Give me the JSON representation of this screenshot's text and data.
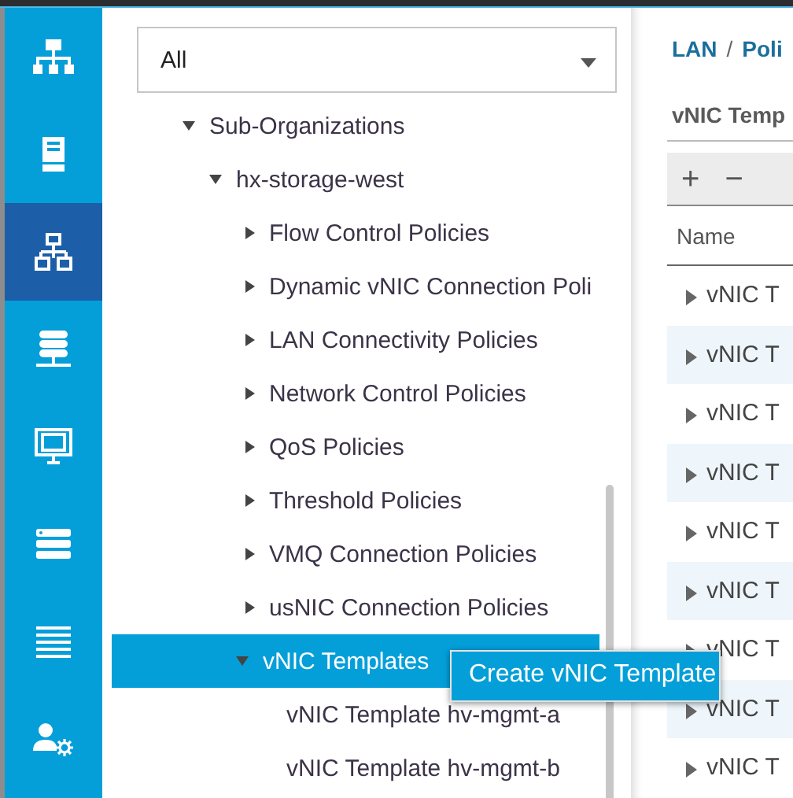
{
  "nav": {
    "items": [
      {
        "kind": "equipment",
        "selected": false
      },
      {
        "kind": "servers",
        "selected": false
      },
      {
        "kind": "lan",
        "selected": true
      },
      {
        "kind": "san",
        "selected": false
      },
      {
        "kind": "vm",
        "selected": false
      },
      {
        "kind": "storage",
        "selected": false
      },
      {
        "kind": "chassis",
        "selected": false
      },
      {
        "kind": "admin",
        "selected": false
      }
    ]
  },
  "tree": {
    "filter": {
      "value": "All"
    },
    "nodes": [
      {
        "label": "Sub-Organizations",
        "expanded": true,
        "selected": false,
        "children": [
          {
            "label": "hx-storage-west",
            "expanded": true,
            "selected": false,
            "children": [
              {
                "label": "Flow Control Policies",
                "expanded": false,
                "selected": false
              },
              {
                "label": "Dynamic vNIC Connection Poli",
                "expanded": false,
                "selected": false
              },
              {
                "label": "LAN Connectivity Policies",
                "expanded": false,
                "selected": false
              },
              {
                "label": "Network Control Policies",
                "expanded": false,
                "selected": false
              },
              {
                "label": "QoS Policies",
                "expanded": false,
                "selected": false
              },
              {
                "label": "Threshold Policies",
                "expanded": false,
                "selected": false
              },
              {
                "label": "VMQ Connection Policies",
                "expanded": false,
                "selected": false
              },
              {
                "label": "usNIC Connection Policies",
                "expanded": false,
                "selected": false
              },
              {
                "label": "vNIC Templates",
                "expanded": true,
                "selected": true,
                "children": [
                  {
                    "label": "vNIC Template hv-mgmt-a",
                    "selected": false
                  },
                  {
                    "label": "vNIC Template hv-mgmt-b",
                    "selected": false
                  }
                ]
              }
            ]
          }
        ]
      }
    ]
  },
  "context_menu": {
    "items": [
      "Create vNIC Template"
    ]
  },
  "detail": {
    "breadcrumb": [
      "LAN",
      "/",
      "Poli"
    ],
    "title": "vNIC Temp",
    "toolbar": [
      "+",
      "−"
    ],
    "columns": [
      "Name"
    ],
    "rows": [
      {
        "label": "vNIC T",
        "expanded": false
      },
      {
        "label": "vNIC T",
        "expanded": false
      },
      {
        "label": "vNIC T",
        "expanded": false
      },
      {
        "label": "vNIC T",
        "expanded": false
      },
      {
        "label": "vNIC T",
        "expanded": false
      },
      {
        "label": "vNIC T",
        "expanded": false
      },
      {
        "label": "vNIC T",
        "expanded": false
      },
      {
        "label": "vNIC T",
        "expanded": false
      },
      {
        "label": "vNIC T",
        "expanded": false
      }
    ]
  }
}
